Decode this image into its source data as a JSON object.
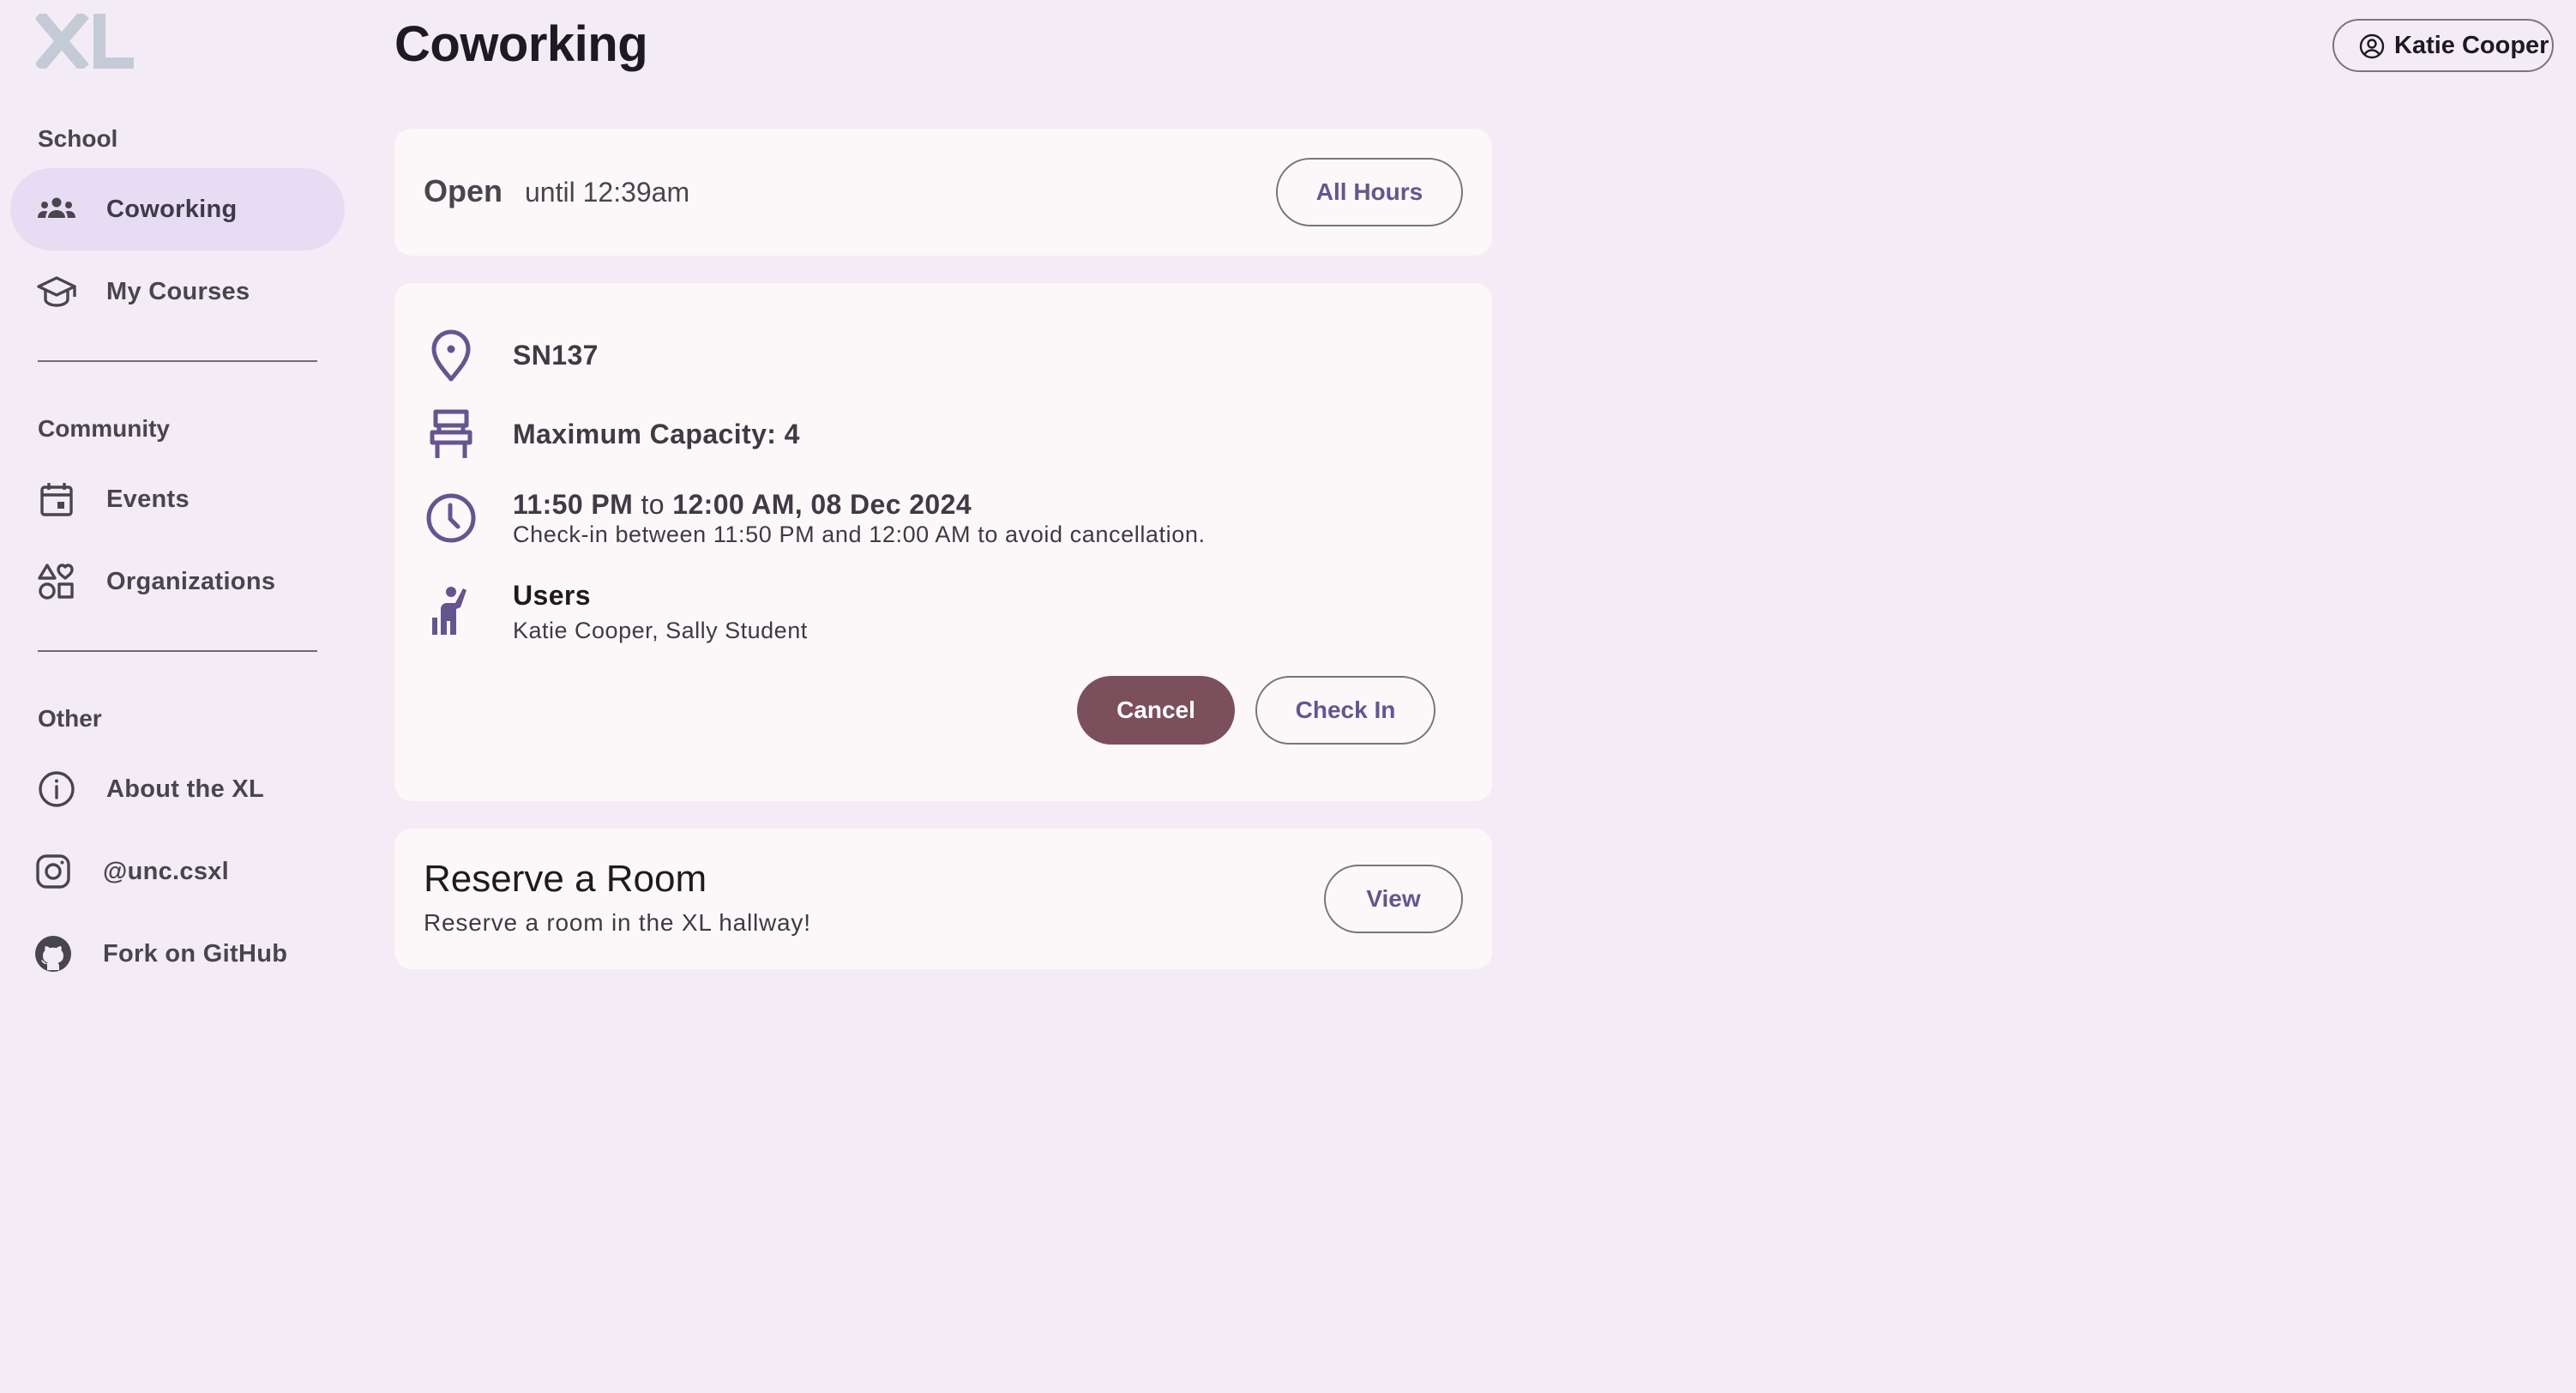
{
  "app": {
    "page_title": "Coworking"
  },
  "sidebar": {
    "sections": [
      {
        "label": "School"
      },
      {
        "label": "Community"
      },
      {
        "label": "Other"
      }
    ],
    "items": [
      {
        "label": "Coworking",
        "icon": "groups-icon",
        "active": true
      },
      {
        "label": "My Courses",
        "icon": "school-icon"
      },
      {
        "label": "Events",
        "icon": "calendar-icon"
      },
      {
        "label": "Organizations",
        "icon": "interests-icon"
      },
      {
        "label": "About the XL",
        "icon": "info-icon"
      },
      {
        "label": "@unc.csxl",
        "icon": "instagram-icon"
      },
      {
        "label": "Fork on GitHub",
        "icon": "github-icon"
      }
    ]
  },
  "header": {
    "profile_label": "Katie Cooper",
    "profile_icon": "account-circle-icon"
  },
  "status_card": {
    "status": "Open",
    "hours_text": "until 12:39am",
    "all_hours_label": "All Hours"
  },
  "reservation": {
    "room": "SN137",
    "capacity_text": "Maximum Capacity: 4",
    "start_time": "11:50 PM",
    "to_word": "to",
    "end_time": "12:00 AM, 08 Dec 2024",
    "checkin_note": "Check-in between 11:50 PM and 12:00 AM to avoid cancellation.",
    "users_title": "Users",
    "users_list": "Katie Cooper, Sally Student",
    "cancel_label": "Cancel",
    "checkin_label": "Check In"
  },
  "reserve_card": {
    "title": "Reserve a Room",
    "subtitle": "Reserve a room in the XL hallway!",
    "view_label": "View"
  },
  "colors": {
    "background": "#f3ecf6",
    "card": "#fcf7f8",
    "accent": "#65558f",
    "active_nav": "#e6dcf3",
    "cancel_button": "#7b4f5b"
  }
}
